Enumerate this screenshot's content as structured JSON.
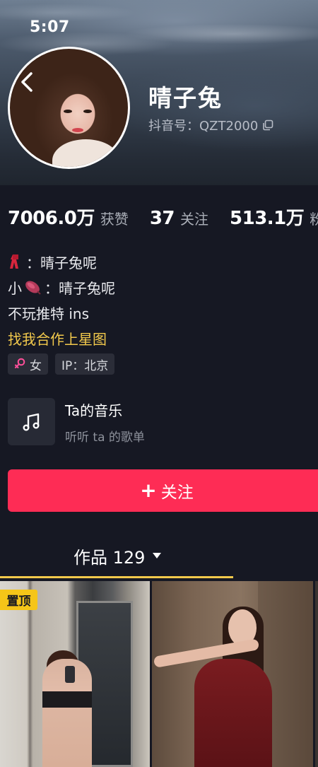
{
  "status_bar": {
    "time": "5:07"
  },
  "profile": {
    "nickname": "晴子兔",
    "douyin_id": "抖音号：QZT2000"
  },
  "stats": [
    {
      "number": "7006.0万",
      "label": "获赞"
    },
    {
      "number": "37",
      "label": "关注"
    },
    {
      "number": "513.1万",
      "label": "粉"
    }
  ],
  "bio": {
    "line1": "：晴子兔呢",
    "line2_prefix": "小",
    "line2": "：晴子兔呢",
    "line3": "不玩推特 ins",
    "link": "找我合作上星图"
  },
  "tags": {
    "gender": "女",
    "ip": "IP：北京"
  },
  "music": {
    "title": "Ta的音乐",
    "subtitle": "听听 ta 的歌单"
  },
  "follow_button": {
    "plus": "+",
    "label": "关注"
  },
  "works_tab": {
    "label": "作品 129"
  },
  "videos": [
    {
      "badge": "置顶"
    },
    {},
    {}
  ],
  "colors": {
    "background": "#161823",
    "follow_button": "#fe2c55",
    "link": "#f2c94c",
    "pin_badge": "#f5c518",
    "tab_indicator": "#f2c94c"
  },
  "icons": {
    "back": "chevron-left-icon",
    "copy": "copy-icon",
    "scarf_emoji": "scarf-icon",
    "sweet_potato_emoji": "sweet-potato-icon",
    "female": "female-icon",
    "music": "music-note-icon",
    "dropdown": "caret-down-icon"
  }
}
